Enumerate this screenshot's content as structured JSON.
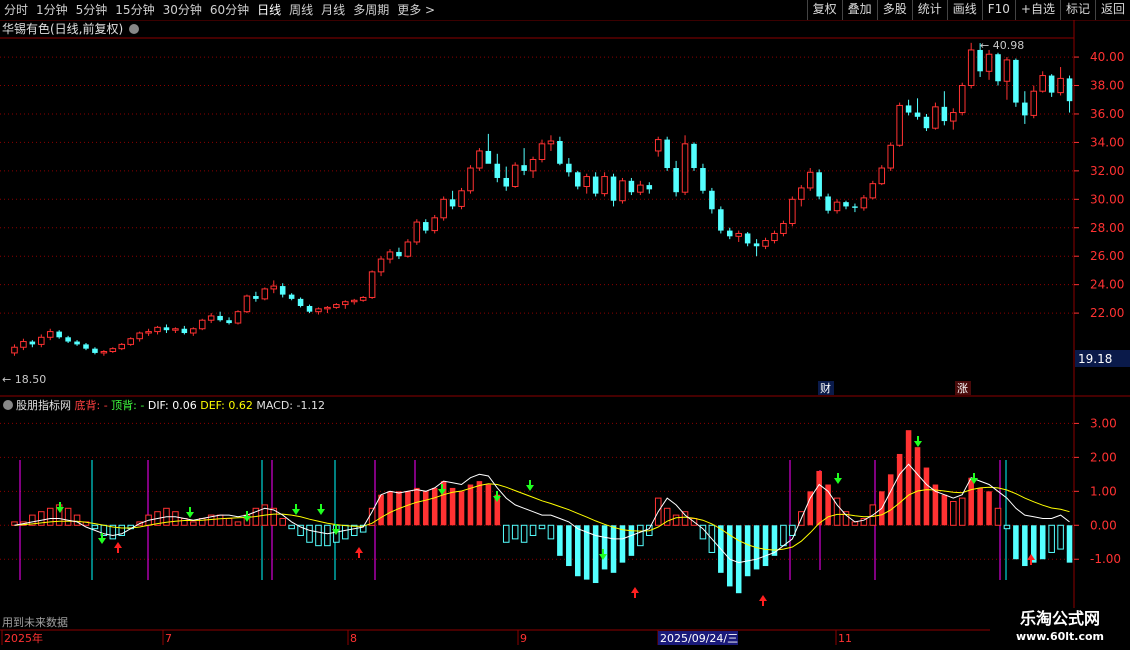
{
  "toolbar": {
    "periods": [
      "分时",
      "1分钟",
      "5分钟",
      "15分钟",
      "30分钟",
      "60分钟",
      "日线",
      "周线",
      "月线",
      "多周期",
      "更多"
    ],
    "active_period": "日线",
    "more_arrow": ">",
    "right_buttons": [
      "复权",
      "叠加",
      "多股",
      "统计",
      "画线",
      "F10",
      "+自选",
      "标记",
      "返回"
    ]
  },
  "main_chart": {
    "title": "华锡有色(日线,前复权)",
    "high_label": "40.98",
    "low_label": "18.50",
    "current_price": "19.18",
    "badge_finance": "财",
    "badge_rise": "涨",
    "y_ticks": [
      "40.00",
      "38.00",
      "36.00",
      "34.00",
      "32.00",
      "30.00",
      "28.00",
      "26.00",
      "24.00",
      "22.00"
    ]
  },
  "indicator": {
    "name": "股朋指标网",
    "label_bottom": "底背:",
    "val_bottom": "-",
    "label_top": "顶背:",
    "val_top": "-",
    "dif_label": "DIF: 0.06",
    "def_label": "DEF: 0.62",
    "macd_label": "MACD: -1.12",
    "y_ticks": [
      "3.00",
      "2.00",
      "1.00",
      "0.00",
      "-1.00"
    ],
    "future_note": "用到未来数据"
  },
  "time_axis": {
    "labels": [
      "2025年",
      "7",
      "8",
      "9",
      "2025/09/24/三",
      "11"
    ]
  },
  "watermark": {
    "line1": "乐淘公式网",
    "line2": "www.60lt.com"
  },
  "colors": {
    "up": "#ff3232",
    "down": "#54ffff",
    "grid": "#8b0000",
    "dif": "#ffffff",
    "dea": "#ffff00",
    "magenta": "#ff00ff",
    "cyan": "#00ffff"
  },
  "chart_data": {
    "type": "candlestick",
    "price_range": [
      18.5,
      40.98
    ],
    "candles": [
      [
        19.2,
        19.8,
        19.0,
        19.6
      ],
      [
        19.6,
        20.2,
        19.4,
        20.0
      ],
      [
        20.0,
        20.1,
        19.6,
        19.8
      ],
      [
        19.8,
        20.5,
        19.6,
        20.3
      ],
      [
        20.3,
        20.9,
        20.1,
        20.7
      ],
      [
        20.7,
        20.8,
        20.2,
        20.3
      ],
      [
        20.3,
        20.4,
        19.9,
        20.0
      ],
      [
        20.0,
        20.1,
        19.7,
        19.8
      ],
      [
        19.8,
        19.9,
        19.4,
        19.5
      ],
      [
        19.5,
        19.6,
        19.1,
        19.2
      ],
      [
        19.2,
        19.4,
        19.0,
        19.3
      ],
      [
        19.3,
        19.6,
        19.2,
        19.5
      ],
      [
        19.5,
        19.9,
        19.4,
        19.8
      ],
      [
        19.8,
        20.3,
        19.7,
        20.2
      ],
      [
        20.2,
        20.7,
        20.0,
        20.6
      ],
      [
        20.6,
        20.9,
        20.4,
        20.7
      ],
      [
        20.7,
        21.1,
        20.5,
        21.0
      ],
      [
        21.0,
        21.2,
        20.6,
        20.8
      ],
      [
        20.8,
        21.0,
        20.6,
        20.9
      ],
      [
        20.9,
        21.1,
        20.5,
        20.6
      ],
      [
        20.6,
        21.0,
        20.4,
        20.9
      ],
      [
        20.9,
        21.6,
        20.8,
        21.5
      ],
      [
        21.5,
        22.0,
        21.3,
        21.8
      ],
      [
        21.8,
        22.1,
        21.4,
        21.5
      ],
      [
        21.5,
        21.7,
        21.2,
        21.3
      ],
      [
        21.3,
        22.2,
        21.2,
        22.1
      ],
      [
        22.1,
        23.3,
        22.0,
        23.2
      ],
      [
        23.2,
        23.5,
        22.8,
        23.0
      ],
      [
        23.0,
        23.8,
        22.9,
        23.7
      ],
      [
        23.7,
        24.3,
        23.4,
        23.9
      ],
      [
        23.9,
        24.1,
        23.1,
        23.3
      ],
      [
        23.3,
        23.4,
        22.9,
        23.0
      ],
      [
        23.0,
        23.1,
        22.4,
        22.5
      ],
      [
        22.5,
        22.6,
        22.0,
        22.1
      ],
      [
        22.1,
        22.4,
        21.9,
        22.3
      ],
      [
        22.3,
        22.5,
        22.0,
        22.4
      ],
      [
        22.4,
        22.7,
        22.3,
        22.6
      ],
      [
        22.6,
        22.9,
        22.3,
        22.8
      ],
      [
        22.8,
        23.0,
        22.6,
        22.9
      ],
      [
        22.9,
        23.2,
        22.8,
        23.1
      ],
      [
        23.1,
        25.0,
        23.0,
        24.9
      ],
      [
        24.9,
        26.0,
        24.6,
        25.8
      ],
      [
        25.8,
        26.5,
        25.5,
        26.3
      ],
      [
        26.3,
        26.6,
        25.8,
        26.0
      ],
      [
        26.0,
        27.2,
        25.9,
        27.0
      ],
      [
        27.0,
        28.6,
        26.8,
        28.4
      ],
      [
        28.4,
        28.6,
        27.6,
        27.8
      ],
      [
        27.8,
        28.9,
        27.6,
        28.7
      ],
      [
        28.7,
        30.2,
        28.5,
        30.0
      ],
      [
        30.0,
        30.6,
        29.3,
        29.5
      ],
      [
        29.5,
        30.8,
        29.3,
        30.6
      ],
      [
        30.6,
        32.4,
        30.4,
        32.2
      ],
      [
        32.2,
        33.6,
        32.0,
        33.4
      ],
      [
        33.4,
        34.6,
        33.0,
        32.5
      ],
      [
        32.5,
        33.2,
        31.2,
        31.5
      ],
      [
        31.5,
        32.3,
        30.6,
        30.9
      ],
      [
        30.9,
        32.6,
        30.8,
        32.4
      ],
      [
        32.4,
        33.6,
        31.7,
        32.0
      ],
      [
        32.0,
        33.0,
        31.5,
        32.8
      ],
      [
        32.8,
        34.2,
        32.6,
        33.9
      ],
      [
        33.9,
        34.5,
        33.4,
        34.1
      ],
      [
        34.1,
        34.4,
        32.4,
        32.5
      ],
      [
        32.5,
        32.9,
        31.6,
        31.9
      ],
      [
        31.9,
        32.0,
        30.7,
        30.9
      ],
      [
        30.9,
        31.8,
        30.4,
        31.6
      ],
      [
        31.6,
        31.9,
        30.2,
        30.4
      ],
      [
        30.4,
        31.9,
        30.2,
        31.6
      ],
      [
        31.6,
        31.8,
        29.5,
        29.9
      ],
      [
        29.9,
        31.5,
        29.7,
        31.3
      ],
      [
        31.3,
        31.5,
        30.3,
        30.5
      ],
      [
        30.5,
        31.3,
        30.3,
        31.0
      ],
      [
        31.0,
        31.2,
        30.4,
        30.7
      ],
      [
        33.4,
        34.4,
        33.0,
        34.2
      ],
      [
        34.2,
        34.4,
        32.0,
        32.2
      ],
      [
        32.2,
        32.7,
        30.2,
        30.5
      ],
      [
        30.5,
        34.5,
        30.3,
        33.9
      ],
      [
        33.9,
        34.0,
        32.0,
        32.2
      ],
      [
        32.2,
        32.5,
        30.4,
        30.6
      ],
      [
        30.6,
        30.8,
        29.0,
        29.3
      ],
      [
        29.3,
        29.5,
        27.6,
        27.8
      ],
      [
        27.8,
        28.0,
        27.2,
        27.4
      ],
      [
        27.4,
        27.8,
        27.0,
        27.6
      ],
      [
        27.6,
        27.7,
        26.7,
        26.9
      ],
      [
        26.9,
        27.2,
        26.0,
        26.7
      ],
      [
        26.7,
        27.3,
        26.5,
        27.1
      ],
      [
        27.1,
        27.8,
        26.9,
        27.6
      ],
      [
        27.6,
        28.5,
        27.4,
        28.3
      ],
      [
        28.3,
        30.2,
        28.1,
        30.0
      ],
      [
        30.0,
        31.0,
        29.5,
        30.8
      ],
      [
        30.8,
        32.2,
        30.6,
        31.9
      ],
      [
        31.9,
        32.1,
        30.0,
        30.2
      ],
      [
        30.2,
        30.4,
        29.0,
        29.2
      ],
      [
        29.2,
        30.0,
        29.0,
        29.8
      ],
      [
        29.8,
        29.9,
        29.3,
        29.5
      ],
      [
        29.5,
        29.7,
        29.1,
        29.4
      ],
      [
        29.4,
        30.3,
        29.2,
        30.1
      ],
      [
        30.1,
        31.3,
        30.0,
        31.1
      ],
      [
        31.1,
        32.4,
        31.0,
        32.2
      ],
      [
        32.2,
        34.0,
        32.0,
        33.8
      ],
      [
        33.8,
        36.8,
        33.7,
        36.6
      ],
      [
        36.6,
        37.0,
        35.9,
        36.1
      ],
      [
        36.1,
        37.1,
        35.6,
        35.8
      ],
      [
        35.8,
        36.0,
        34.8,
        35.0
      ],
      [
        35.0,
        36.8,
        34.9,
        36.5
      ],
      [
        36.5,
        37.6,
        35.2,
        35.5
      ],
      [
        35.5,
        36.4,
        34.9,
        36.1
      ],
      [
        36.1,
        38.2,
        35.9,
        38.0
      ],
      [
        38.0,
        41.0,
        37.8,
        40.5
      ],
      [
        40.5,
        40.98,
        38.6,
        39.0
      ],
      [
        39.0,
        40.5,
        38.4,
        40.2
      ],
      [
        40.2,
        40.3,
        38.0,
        38.3
      ],
      [
        38.3,
        40.0,
        37.0,
        39.8
      ],
      [
        39.8,
        39.9,
        36.5,
        36.8
      ],
      [
        36.8,
        37.6,
        35.3,
        35.9
      ],
      [
        35.9,
        38.0,
        35.7,
        37.6
      ],
      [
        37.6,
        39.0,
        37.5,
        38.7
      ],
      [
        38.7,
        38.8,
        37.2,
        37.5
      ],
      [
        37.5,
        39.3,
        37.3,
        38.5
      ],
      [
        38.5,
        38.7,
        36.1,
        36.9
      ]
    ],
    "macd": {
      "bars": [
        0.1,
        0.1,
        0.3,
        0.4,
        0.5,
        0.6,
        0.5,
        0.3,
        0.1,
        -0.1,
        -0.3,
        -0.4,
        -0.3,
        -0.1,
        0.1,
        0.3,
        0.4,
        0.5,
        0.4,
        0.2,
        0.1,
        0.2,
        0.3,
        0.3,
        0.2,
        0.1,
        0.3,
        0.5,
        0.6,
        0.5,
        0.2,
        -0.1,
        -0.3,
        -0.5,
        -0.6,
        -0.6,
        -0.5,
        -0.4,
        -0.3,
        -0.2,
        0.5,
        0.9,
        1.0,
        1.0,
        1.0,
        1.1,
        1.0,
        1.1,
        1.3,
        1.1,
        1.0,
        1.2,
        1.3,
        1.2,
        0.9,
        -0.5,
        -0.4,
        -0.5,
        -0.3,
        -0.1,
        -0.4,
        -0.9,
        -1.2,
        -1.5,
        -1.6,
        -1.7,
        -1.3,
        -1.4,
        -1.1,
        -0.9,
        -0.6,
        -0.3,
        0.8,
        0.5,
        0.3,
        0.4,
        0.2,
        -0.4,
        -0.8,
        -1.4,
        -1.8,
        -2.0,
        -1.5,
        -1.3,
        -1.2,
        -0.9,
        -0.6,
        -0.3,
        0.4,
        1.0,
        1.6,
        1.2,
        0.8,
        0.4,
        0.1,
        0.2,
        0.6,
        1.0,
        1.5,
        2.1,
        2.8,
        2.3,
        1.7,
        1.2,
        0.9,
        0.7,
        0.8,
        1.4,
        1.1,
        1.0,
        0.5,
        -0.1,
        -1.0,
        -1.2,
        -1.1,
        -1.0,
        -0.8,
        -0.7,
        -1.1
      ],
      "dif": [
        0.0,
        0.05,
        0.1,
        0.15,
        0.2,
        0.2,
        0.15,
        0.1,
        -0.05,
        -0.15,
        -0.25,
        -0.3,
        -0.25,
        -0.1,
        0.05,
        0.15,
        0.2,
        0.25,
        0.25,
        0.2,
        0.15,
        0.2,
        0.25,
        0.3,
        0.3,
        0.25,
        0.3,
        0.4,
        0.5,
        0.45,
        0.3,
        0.1,
        -0.05,
        -0.15,
        -0.2,
        -0.25,
        -0.2,
        -0.15,
        -0.1,
        -0.05,
        0.4,
        0.9,
        1.0,
        0.95,
        1.0,
        1.05,
        1.0,
        1.1,
        1.3,
        1.25,
        1.2,
        1.4,
        1.5,
        1.45,
        1.1,
        0.8,
        0.6,
        0.5,
        0.4,
        0.3,
        0.3,
        0.2,
        0.1,
        -0.1,
        -0.2,
        -0.3,
        -0.35,
        -0.4,
        -0.4,
        -0.3,
        -0.2,
        -0.1,
        0.4,
        0.8,
        0.6,
        0.3,
        0.1,
        -0.1,
        -0.4,
        -0.7,
        -1.0,
        -1.1,
        -1.05,
        -1.0,
        -0.9,
        -0.8,
        -0.6,
        -0.4,
        0.2,
        0.8,
        1.2,
        1.0,
        0.6,
        0.3,
        0.1,
        0.15,
        0.3,
        0.5,
        1.0,
        1.5,
        1.8,
        1.5,
        1.2,
        1.0,
        0.9,
        0.8,
        0.9,
        1.4,
        1.3,
        1.2,
        1.0,
        0.8,
        0.5,
        0.3,
        0.25,
        0.2,
        0.2,
        0.3,
        0.1
      ],
      "dea": [
        0.0,
        0.02,
        0.04,
        0.07,
        0.1,
        0.12,
        0.12,
        0.12,
        0.09,
        0.05,
        0.0,
        -0.05,
        -0.08,
        -0.08,
        -0.05,
        0.0,
        0.05,
        0.09,
        0.12,
        0.14,
        0.14,
        0.15,
        0.17,
        0.19,
        0.21,
        0.22,
        0.23,
        0.26,
        0.3,
        0.33,
        0.33,
        0.3,
        0.25,
        0.18,
        0.12,
        0.06,
        0.02,
        -0.01,
        -0.03,
        -0.03,
        0.06,
        0.23,
        0.38,
        0.49,
        0.59,
        0.68,
        0.74,
        0.81,
        0.9,
        0.97,
        1.01,
        1.09,
        1.17,
        1.22,
        1.2,
        1.12,
        1.02,
        0.92,
        0.82,
        0.72,
        0.64,
        0.55,
        0.46,
        0.35,
        0.24,
        0.13,
        0.03,
        -0.06,
        -0.13,
        -0.16,
        -0.17,
        -0.16,
        -0.05,
        0.12,
        0.22,
        0.24,
        0.21,
        0.15,
        0.04,
        -0.11,
        -0.29,
        -0.45,
        -0.57,
        -0.66,
        -0.71,
        -0.73,
        -0.7,
        -0.64,
        -0.47,
        -0.22,
        0.06,
        0.25,
        0.32,
        0.32,
        0.28,
        0.25,
        0.26,
        0.31,
        0.45,
        0.66,
        0.89,
        1.01,
        1.05,
        1.04,
        1.01,
        0.97,
        0.96,
        1.05,
        1.1,
        1.12,
        1.1,
        1.04,
        0.93,
        0.8,
        0.69,
        0.59,
        0.51,
        0.47,
        0.4
      ]
    }
  }
}
